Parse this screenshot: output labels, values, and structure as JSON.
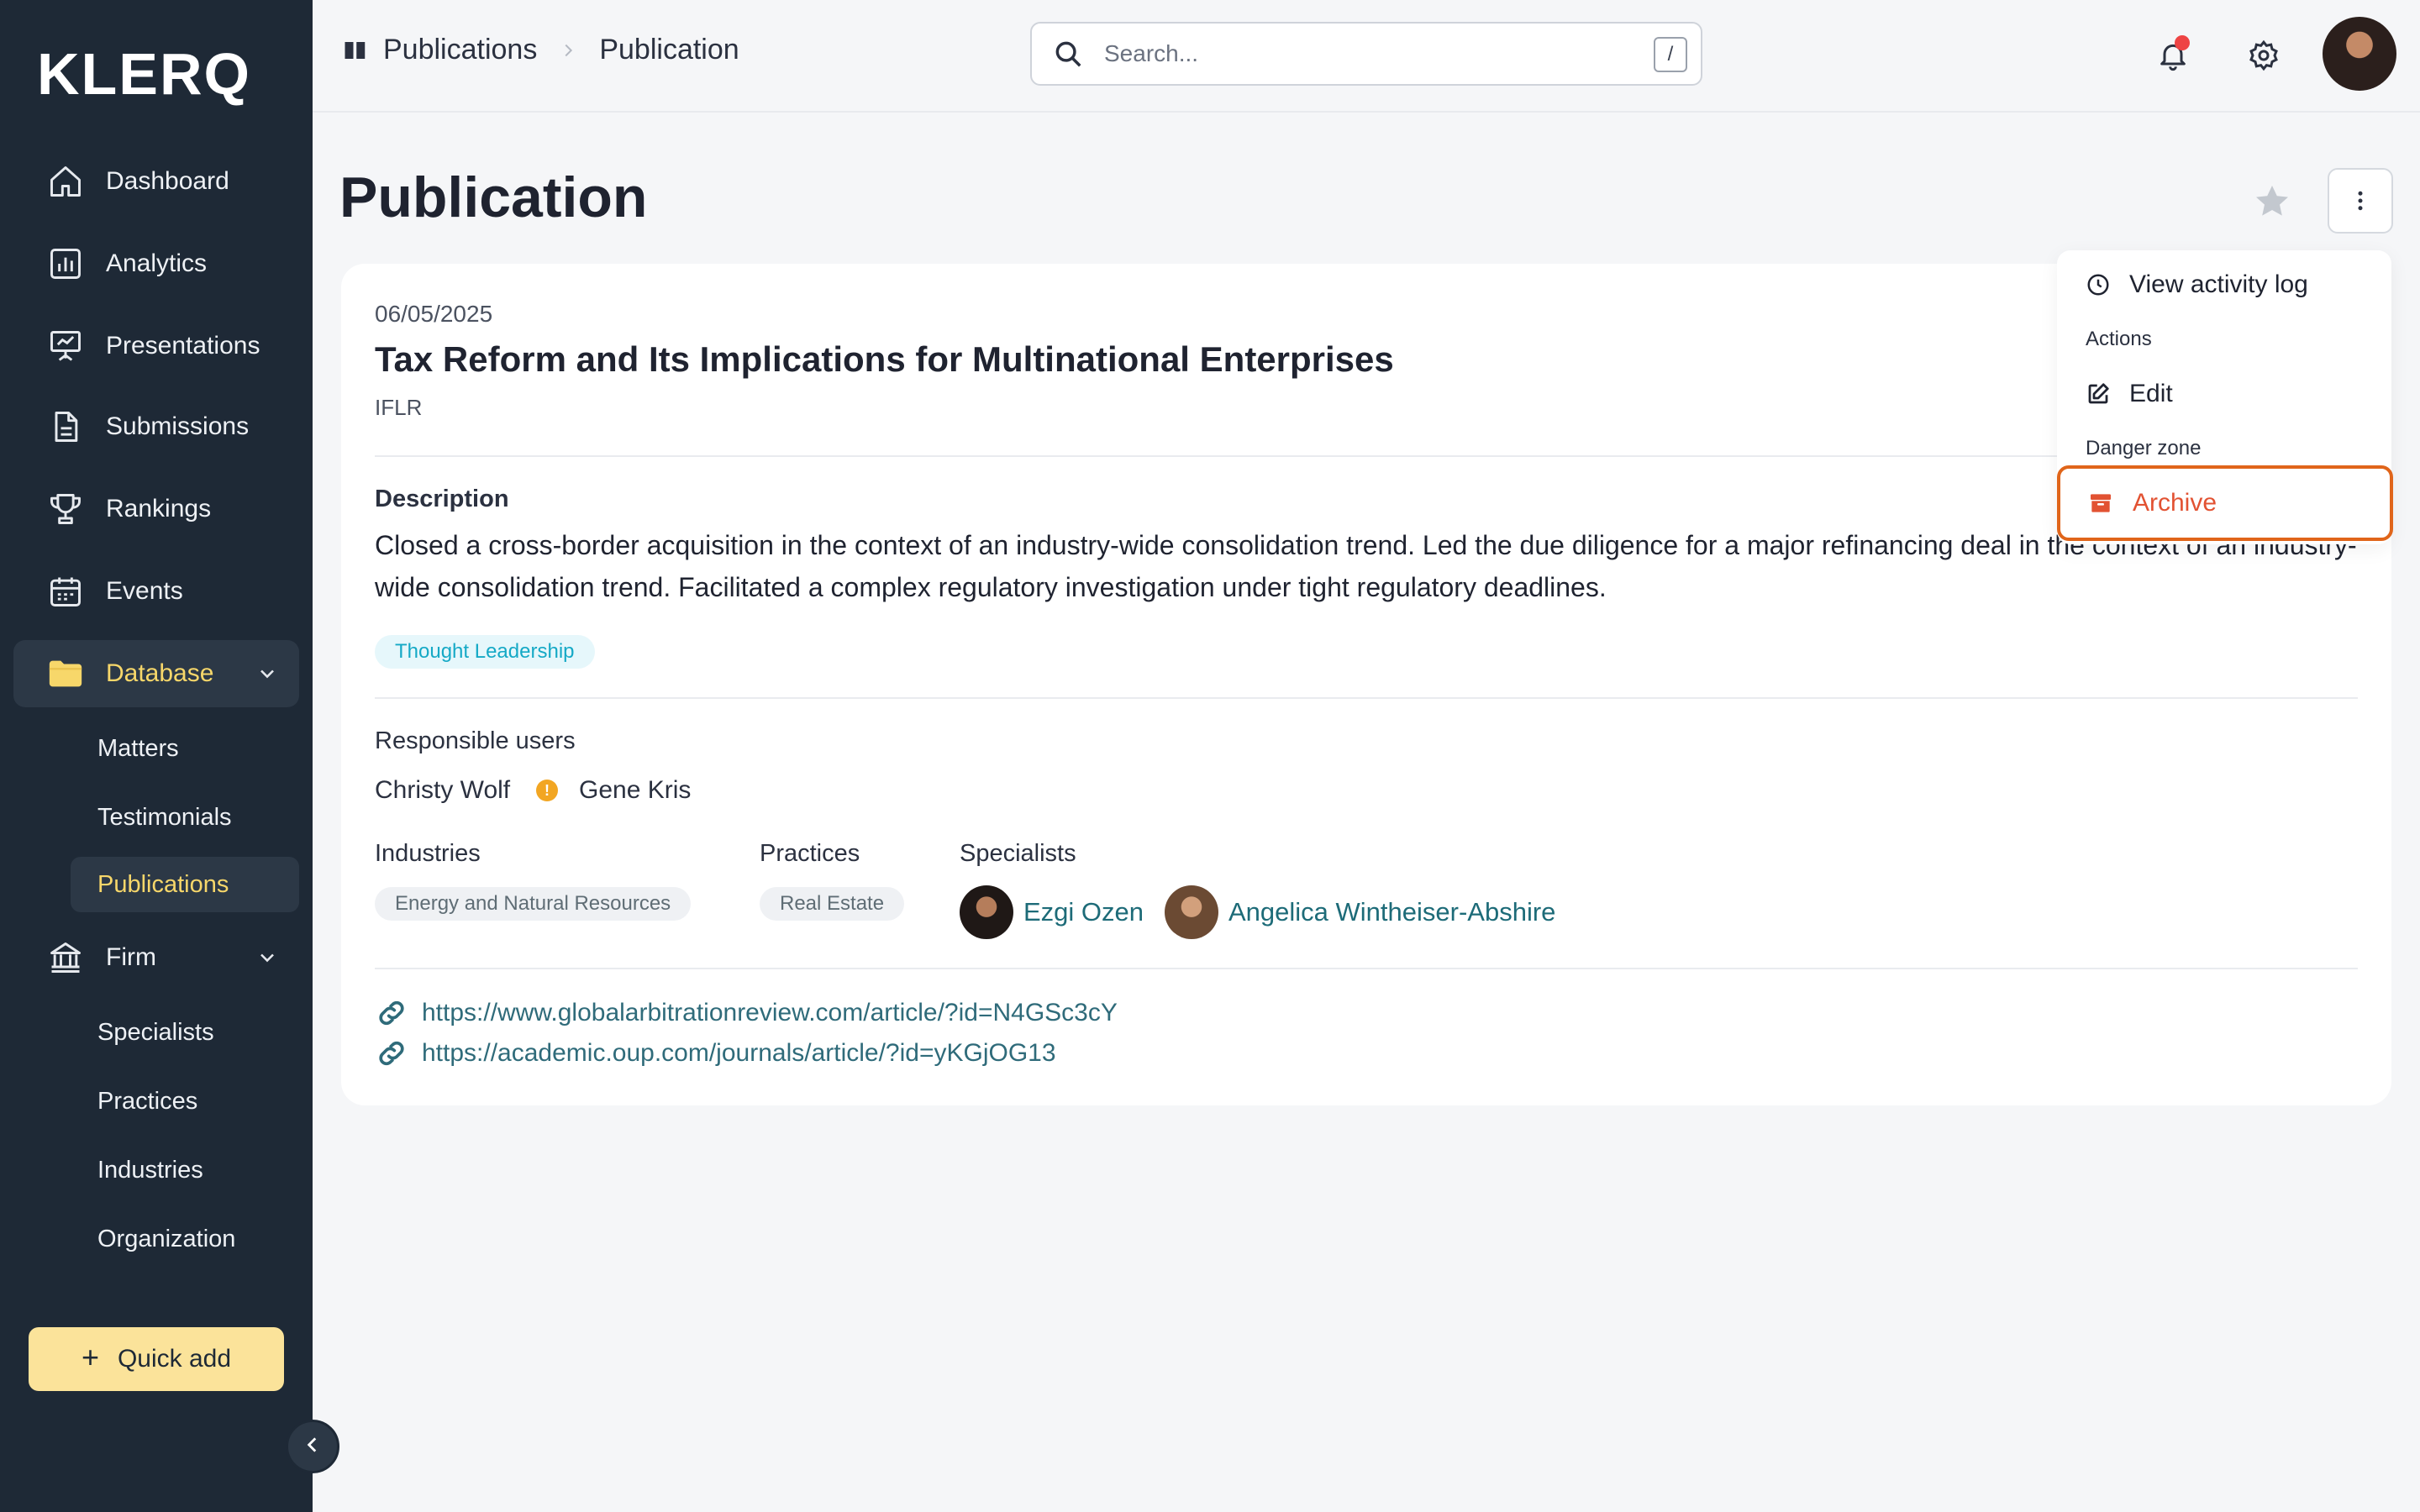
{
  "app": {
    "logo": "KLERQ"
  },
  "sidebar": {
    "items": [
      {
        "label": "Dashboard",
        "icon": "home-icon"
      },
      {
        "label": "Analytics",
        "icon": "bar-chart-icon"
      },
      {
        "label": "Presentations",
        "icon": "presentation-icon"
      },
      {
        "label": "Submissions",
        "icon": "document-icon"
      },
      {
        "label": "Rankings",
        "icon": "trophy-icon"
      },
      {
        "label": "Events",
        "icon": "calendar-icon"
      },
      {
        "label": "Database",
        "icon": "folder-icon"
      },
      {
        "label": "Firm",
        "icon": "bank-icon"
      }
    ],
    "database_sub": [
      {
        "label": "Matters"
      },
      {
        "label": "Testimonials"
      },
      {
        "label": "Publications"
      }
    ],
    "firm_sub": [
      {
        "label": "Specialists"
      },
      {
        "label": "Practices"
      },
      {
        "label": "Industries"
      },
      {
        "label": "Organization"
      }
    ],
    "quick_add": "Quick add"
  },
  "topbar": {
    "breadcrumb": [
      "Publications",
      "Publication"
    ],
    "search_placeholder": "Search...",
    "search_shortcut": "/"
  },
  "page": {
    "title": "Publication"
  },
  "publication": {
    "date": "06/05/2025",
    "title": "Tax Reform and Its Implications for Multinational Enterprises",
    "source": "IFLR",
    "description_label": "Description",
    "description": "Closed a cross-border acquisition in the context of an industry-wide consolidation trend. Led the due diligence for a major refinancing deal in the context of an industry-wide consolidation trend. Facilitated a complex regulatory investigation under tight regulatory deadlines.",
    "tag": "Thought Leadership",
    "responsible_label": "Responsible users",
    "responsible_users": [
      "Christy Wolf",
      "Gene Kris"
    ],
    "warning_glyph": "!",
    "industries_label": "Industries",
    "industries": [
      "Energy and Natural Resources"
    ],
    "practices_label": "Practices",
    "practices": [
      "Real Estate"
    ],
    "specialists_label": "Specialists",
    "specialists": [
      "Ezgi Ozen",
      "Angelica Wintheiser-Abshire"
    ],
    "links": [
      "https://www.globalarbitrationreview.com/article/?id=N4GSc3cY",
      "https://academic.oup.com/journals/article/?id=yKGjOG13"
    ]
  },
  "menu": {
    "view_activity": "View activity log",
    "actions_label": "Actions",
    "edit": "Edit",
    "danger_label": "Danger zone",
    "archive": "Archive",
    "colors": {
      "danger": "#e25232",
      "highlight": "#e0651a"
    }
  },
  "colors": {
    "sidebar_bg": "#1e2936",
    "accent_yellow": "#f7d76a",
    "quick_add_bg": "#fbe39a",
    "tag_cyan": "#15a9c6",
    "link_teal": "#2f6b7a"
  }
}
